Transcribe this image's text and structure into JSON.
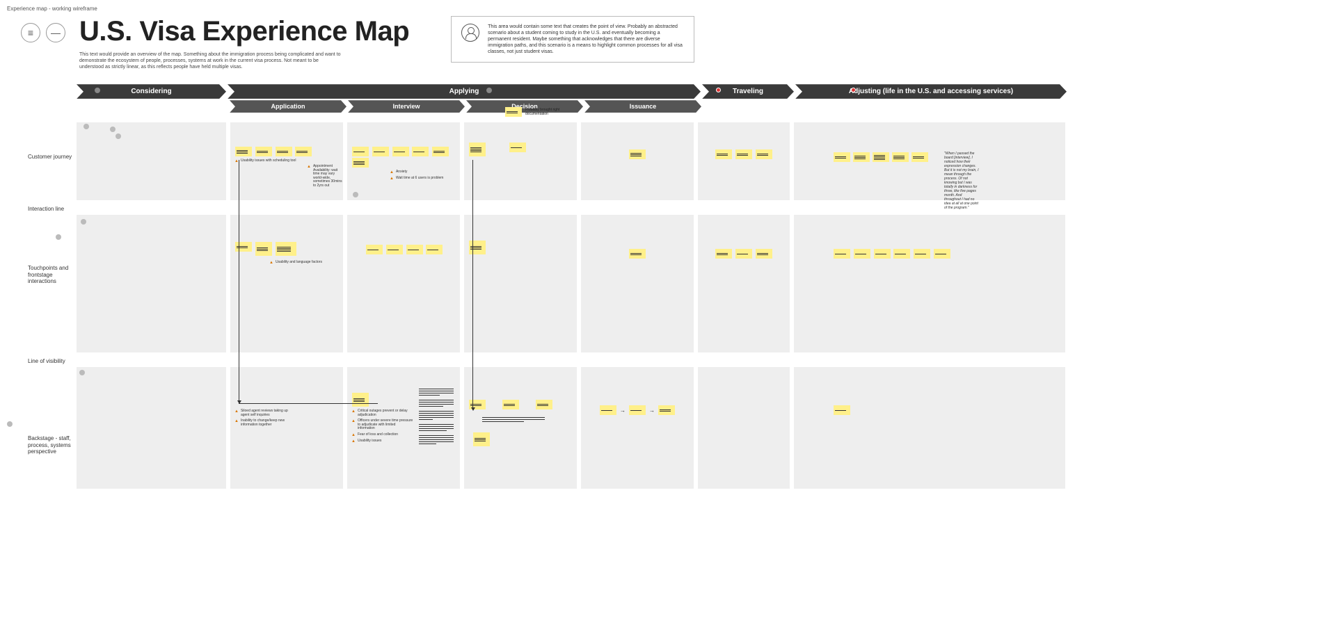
{
  "breadcrumb": "Experience map - working wireframe",
  "title": "U.S. Visa Experience Map",
  "overview": "This text would provide an overview of the map. Something about the immigration process being complicated and want to demonstrate the ecosystem of people, processes, systems at work in the current visa process. Not meant to be understood as strictly linear, as this reflects people have held multiple visas.",
  "pov": "This area would contain some text that creates the point of view. Probably an abstracted scenario about a student coming to study in the U.S. and eventually becoming a permanent resident. Maybe something that acknowledges that there are diverse immigration paths, and this scenario is a means to highlight common processes for all visa classes, not just student visas.",
  "phases": {
    "considering": "Considering",
    "applying": "Applying",
    "traveling": "Traveling",
    "adjusting": "Adjusting (life in the U.S. and accessing services)"
  },
  "subphases": {
    "application": "Application",
    "interview": "Interview",
    "decision": "Decision",
    "issuance": "Issuance"
  },
  "rows": {
    "customer": "Customer journey",
    "interaction": "Interaction line",
    "touchpoints": "Touchpoints and frontstage interactions",
    "visibility": "Line of visibility",
    "backstage": "Backstage - staff, process, systems perspective"
  },
  "notes": {
    "top_right": "Probably brought right documentation",
    "cj_app_w1": "Usability issues with scheduling tool",
    "cj_app_w2": "Appointment Availability: wait time may vary world-wide, sometimes 30mins to 2yrs out",
    "cj_int_w1": "Anxiety",
    "cj_int_w2": "Wait time at 6 users is problem",
    "tp_app_w1": "Usability and language factors",
    "bs_app_w1": "Siloed agent reviews taking up agent self inquiries",
    "bs_app_w2": "Inability to change/keep new information together",
    "bs_int_w1": "Critical outages prevent or delay adjudication",
    "bs_int_w2": "Officers under severe time pressure to adjudicate with limited information",
    "bs_int_w3": "Fear of loss and collection",
    "bs_int_w4": "Usability issues",
    "quote": "\"When I passed the board [interview], I noticed how their expression changes. But it is not my brain, I mean through the process. Of not knowing but I was totally in darkness for three, like five pages month. And throughout I had no idea at all at one point of the program.\""
  }
}
